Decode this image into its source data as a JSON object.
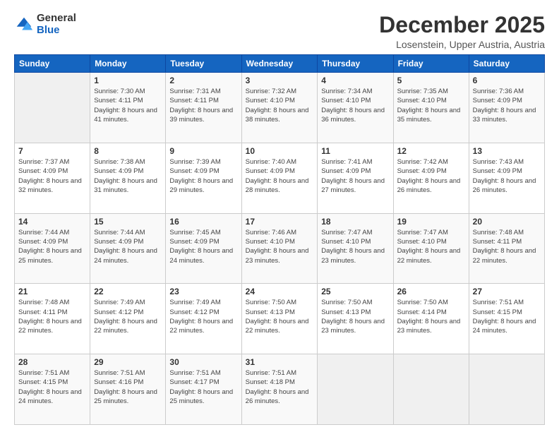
{
  "logo": {
    "general": "General",
    "blue": "Blue"
  },
  "header": {
    "month": "December 2025",
    "location": "Losenstein, Upper Austria, Austria"
  },
  "weekdays": [
    "Sunday",
    "Monday",
    "Tuesday",
    "Wednesday",
    "Thursday",
    "Friday",
    "Saturday"
  ],
  "weeks": [
    [
      {
        "day": "",
        "sunrise": "",
        "sunset": "",
        "daylight": ""
      },
      {
        "day": "1",
        "sunrise": "Sunrise: 7:30 AM",
        "sunset": "Sunset: 4:11 PM",
        "daylight": "Daylight: 8 hours and 41 minutes."
      },
      {
        "day": "2",
        "sunrise": "Sunrise: 7:31 AM",
        "sunset": "Sunset: 4:11 PM",
        "daylight": "Daylight: 8 hours and 39 minutes."
      },
      {
        "day": "3",
        "sunrise": "Sunrise: 7:32 AM",
        "sunset": "Sunset: 4:10 PM",
        "daylight": "Daylight: 8 hours and 38 minutes."
      },
      {
        "day": "4",
        "sunrise": "Sunrise: 7:34 AM",
        "sunset": "Sunset: 4:10 PM",
        "daylight": "Daylight: 8 hours and 36 minutes."
      },
      {
        "day": "5",
        "sunrise": "Sunrise: 7:35 AM",
        "sunset": "Sunset: 4:10 PM",
        "daylight": "Daylight: 8 hours and 35 minutes."
      },
      {
        "day": "6",
        "sunrise": "Sunrise: 7:36 AM",
        "sunset": "Sunset: 4:09 PM",
        "daylight": "Daylight: 8 hours and 33 minutes."
      }
    ],
    [
      {
        "day": "7",
        "sunrise": "Sunrise: 7:37 AM",
        "sunset": "Sunset: 4:09 PM",
        "daylight": "Daylight: 8 hours and 32 minutes."
      },
      {
        "day": "8",
        "sunrise": "Sunrise: 7:38 AM",
        "sunset": "Sunset: 4:09 PM",
        "daylight": "Daylight: 8 hours and 31 minutes."
      },
      {
        "day": "9",
        "sunrise": "Sunrise: 7:39 AM",
        "sunset": "Sunset: 4:09 PM",
        "daylight": "Daylight: 8 hours and 29 minutes."
      },
      {
        "day": "10",
        "sunrise": "Sunrise: 7:40 AM",
        "sunset": "Sunset: 4:09 PM",
        "daylight": "Daylight: 8 hours and 28 minutes."
      },
      {
        "day": "11",
        "sunrise": "Sunrise: 7:41 AM",
        "sunset": "Sunset: 4:09 PM",
        "daylight": "Daylight: 8 hours and 27 minutes."
      },
      {
        "day": "12",
        "sunrise": "Sunrise: 7:42 AM",
        "sunset": "Sunset: 4:09 PM",
        "daylight": "Daylight: 8 hours and 26 minutes."
      },
      {
        "day": "13",
        "sunrise": "Sunrise: 7:43 AM",
        "sunset": "Sunset: 4:09 PM",
        "daylight": "Daylight: 8 hours and 26 minutes."
      }
    ],
    [
      {
        "day": "14",
        "sunrise": "Sunrise: 7:44 AM",
        "sunset": "Sunset: 4:09 PM",
        "daylight": "Daylight: 8 hours and 25 minutes."
      },
      {
        "day": "15",
        "sunrise": "Sunrise: 7:44 AM",
        "sunset": "Sunset: 4:09 PM",
        "daylight": "Daylight: 8 hours and 24 minutes."
      },
      {
        "day": "16",
        "sunrise": "Sunrise: 7:45 AM",
        "sunset": "Sunset: 4:09 PM",
        "daylight": "Daylight: 8 hours and 24 minutes."
      },
      {
        "day": "17",
        "sunrise": "Sunrise: 7:46 AM",
        "sunset": "Sunset: 4:10 PM",
        "daylight": "Daylight: 8 hours and 23 minutes."
      },
      {
        "day": "18",
        "sunrise": "Sunrise: 7:47 AM",
        "sunset": "Sunset: 4:10 PM",
        "daylight": "Daylight: 8 hours and 23 minutes."
      },
      {
        "day": "19",
        "sunrise": "Sunrise: 7:47 AM",
        "sunset": "Sunset: 4:10 PM",
        "daylight": "Daylight: 8 hours and 22 minutes."
      },
      {
        "day": "20",
        "sunrise": "Sunrise: 7:48 AM",
        "sunset": "Sunset: 4:11 PM",
        "daylight": "Daylight: 8 hours and 22 minutes."
      }
    ],
    [
      {
        "day": "21",
        "sunrise": "Sunrise: 7:48 AM",
        "sunset": "Sunset: 4:11 PM",
        "daylight": "Daylight: 8 hours and 22 minutes."
      },
      {
        "day": "22",
        "sunrise": "Sunrise: 7:49 AM",
        "sunset": "Sunset: 4:12 PM",
        "daylight": "Daylight: 8 hours and 22 minutes."
      },
      {
        "day": "23",
        "sunrise": "Sunrise: 7:49 AM",
        "sunset": "Sunset: 4:12 PM",
        "daylight": "Daylight: 8 hours and 22 minutes."
      },
      {
        "day": "24",
        "sunrise": "Sunrise: 7:50 AM",
        "sunset": "Sunset: 4:13 PM",
        "daylight": "Daylight: 8 hours and 22 minutes."
      },
      {
        "day": "25",
        "sunrise": "Sunrise: 7:50 AM",
        "sunset": "Sunset: 4:13 PM",
        "daylight": "Daylight: 8 hours and 23 minutes."
      },
      {
        "day": "26",
        "sunrise": "Sunrise: 7:50 AM",
        "sunset": "Sunset: 4:14 PM",
        "daylight": "Daylight: 8 hours and 23 minutes."
      },
      {
        "day": "27",
        "sunrise": "Sunrise: 7:51 AM",
        "sunset": "Sunset: 4:15 PM",
        "daylight": "Daylight: 8 hours and 24 minutes."
      }
    ],
    [
      {
        "day": "28",
        "sunrise": "Sunrise: 7:51 AM",
        "sunset": "Sunset: 4:15 PM",
        "daylight": "Daylight: 8 hours and 24 minutes."
      },
      {
        "day": "29",
        "sunrise": "Sunrise: 7:51 AM",
        "sunset": "Sunset: 4:16 PM",
        "daylight": "Daylight: 8 hours and 25 minutes."
      },
      {
        "day": "30",
        "sunrise": "Sunrise: 7:51 AM",
        "sunset": "Sunset: 4:17 PM",
        "daylight": "Daylight: 8 hours and 25 minutes."
      },
      {
        "day": "31",
        "sunrise": "Sunrise: 7:51 AM",
        "sunset": "Sunset: 4:18 PM",
        "daylight": "Daylight: 8 hours and 26 minutes."
      },
      {
        "day": "",
        "sunrise": "",
        "sunset": "",
        "daylight": ""
      },
      {
        "day": "",
        "sunrise": "",
        "sunset": "",
        "daylight": ""
      },
      {
        "day": "",
        "sunrise": "",
        "sunset": "",
        "daylight": ""
      }
    ]
  ]
}
